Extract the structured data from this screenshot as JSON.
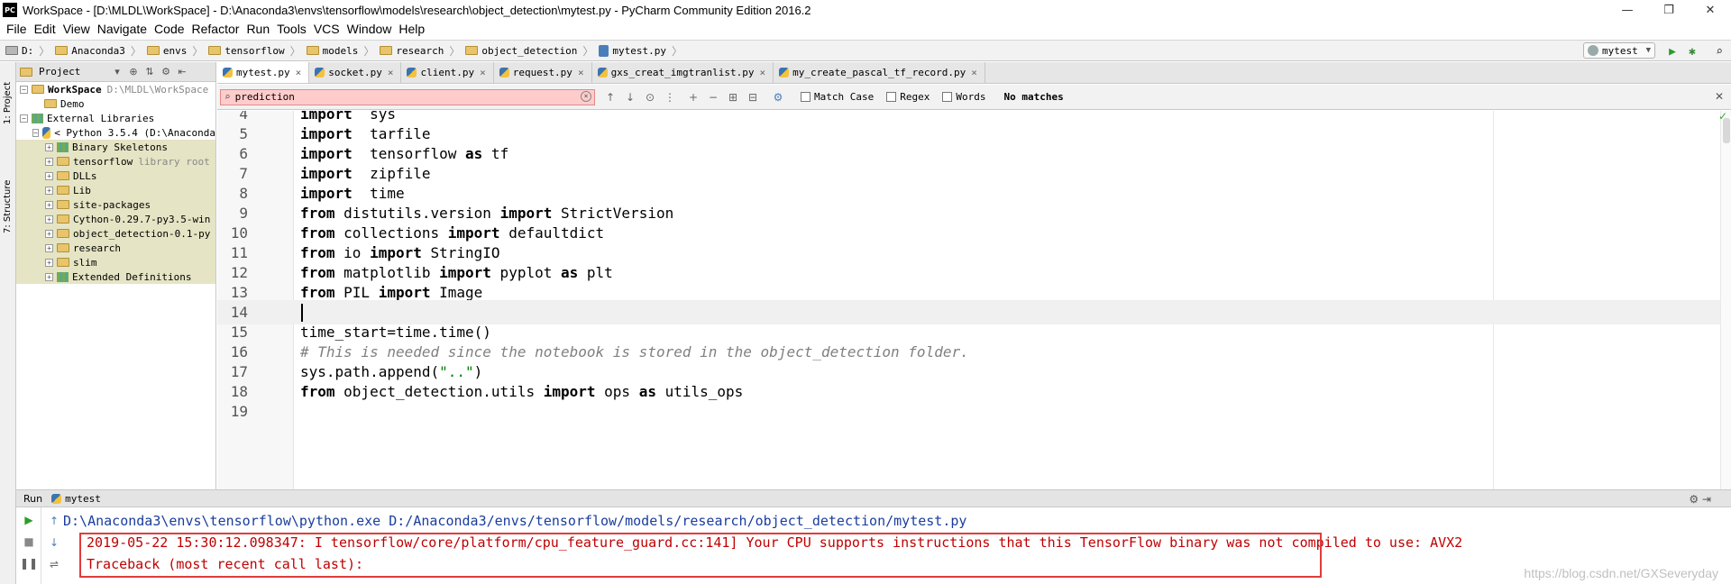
{
  "window": {
    "title": "WorkSpace - [D:\\MLDL\\WorkSpace] - D:\\Anaconda3\\envs\\tensorflow\\models\\research\\object_detection\\mytest.py - PyCharm Community Edition 2016.2",
    "logo_text": "PC",
    "minimize": "—",
    "restore": "❐",
    "close": "✕"
  },
  "menu": [
    "File",
    "Edit",
    "View",
    "Navigate",
    "Code",
    "Refactor",
    "Run",
    "Tools",
    "VCS",
    "Window",
    "Help"
  ],
  "breadcrumb": [
    "D:",
    "Anaconda3",
    "envs",
    "tensorflow",
    "models",
    "research",
    "object_detection",
    "mytest.py"
  ],
  "run_config": "mytest",
  "left_strip": {
    "project_tab": "1: Project",
    "structure_tab": "7: Structure"
  },
  "project_panel": {
    "title": "Project",
    "tree": [
      {
        "label": "WorkSpace",
        "extra": "D:\\MLDL\\WorkSpace",
        "level": 0,
        "toggle": "−",
        "icon": "folder"
      },
      {
        "label": "Demo",
        "level": 1,
        "toggle": "",
        "icon": "folder"
      },
      {
        "label": "External Libraries",
        "level": 0,
        "toggle": "−",
        "icon": "lib"
      },
      {
        "label": "< Python 3.5.4 (D:\\Anaconda",
        "level": 1,
        "toggle": "−",
        "icon": "py"
      },
      {
        "label": "Binary Skeletons",
        "level": 2,
        "toggle": "+",
        "icon": "lib"
      },
      {
        "label": "tensorflow",
        "extra": "library root",
        "level": 2,
        "toggle": "+",
        "icon": "folder"
      },
      {
        "label": "DLLs",
        "level": 2,
        "toggle": "+",
        "icon": "folder"
      },
      {
        "label": "Lib",
        "level": 2,
        "toggle": "+",
        "icon": "folder"
      },
      {
        "label": "site-packages",
        "level": 2,
        "toggle": "+",
        "icon": "folder"
      },
      {
        "label": "Cython-0.29.7-py3.5-win",
        "level": 2,
        "toggle": "+",
        "icon": "folder"
      },
      {
        "label": "object_detection-0.1-py",
        "level": 2,
        "toggle": "+",
        "icon": "folder"
      },
      {
        "label": "research",
        "level": 2,
        "toggle": "+",
        "icon": "folder"
      },
      {
        "label": "slim",
        "level": 2,
        "toggle": "+",
        "icon": "folder"
      },
      {
        "label": "Extended Definitions",
        "level": 2,
        "toggle": "+",
        "icon": "lib"
      }
    ]
  },
  "tabs": [
    {
      "label": "mytest.py",
      "active": true
    },
    {
      "label": "socket.py",
      "active": false
    },
    {
      "label": "client.py",
      "active": false
    },
    {
      "label": "request.py",
      "active": false
    },
    {
      "label": "gxs_creat_imgtranlist.py",
      "active": false
    },
    {
      "label": "my_create_pascal_tf_record.py",
      "active": false
    }
  ],
  "find": {
    "query": "prediction",
    "match_case": "Match Case",
    "regex": "Regex",
    "words": "Words",
    "status": "No matches"
  },
  "code_lines": [
    {
      "n": "4",
      "parts": [
        [
          "kw2",
          "import"
        ],
        [
          "",
          "  sys"
        ]
      ]
    },
    {
      "n": "5",
      "parts": [
        [
          "kw2",
          "import"
        ],
        [
          "",
          "  tarfile"
        ]
      ]
    },
    {
      "n": "6",
      "parts": [
        [
          "kw2",
          "import"
        ],
        [
          "",
          "  tensorflow "
        ],
        [
          "kw2",
          "as"
        ],
        [
          "",
          " tf"
        ]
      ]
    },
    {
      "n": "7",
      "parts": [
        [
          "kw2",
          "import"
        ],
        [
          "",
          "  zipfile"
        ]
      ]
    },
    {
      "n": "8",
      "parts": [
        [
          "kw2",
          "import"
        ],
        [
          "",
          "  time"
        ]
      ]
    },
    {
      "n": "9",
      "parts": [
        [
          "kw2",
          "from"
        ],
        [
          "",
          " distutils.version "
        ],
        [
          "kw2",
          "import"
        ],
        [
          "",
          " StrictVersion"
        ]
      ]
    },
    {
      "n": "10",
      "parts": [
        [
          "kw2",
          "from"
        ],
        [
          "",
          " collections "
        ],
        [
          "kw2",
          "import"
        ],
        [
          "",
          " defaultdict"
        ]
      ]
    },
    {
      "n": "11",
      "parts": [
        [
          "kw2",
          "from"
        ],
        [
          "",
          " io "
        ],
        [
          "kw2",
          "import"
        ],
        [
          "",
          " StringIO"
        ]
      ]
    },
    {
      "n": "12",
      "parts": [
        [
          "kw2",
          "from"
        ],
        [
          "",
          " matplotlib "
        ],
        [
          "kw2",
          "import"
        ],
        [
          "",
          " pyplot "
        ],
        [
          "kw2",
          "as"
        ],
        [
          "",
          " plt"
        ]
      ]
    },
    {
      "n": "13",
      "parts": [
        [
          "kw2",
          "from"
        ],
        [
          "",
          " PIL "
        ],
        [
          "kw2",
          "import"
        ],
        [
          "",
          " Image"
        ]
      ]
    },
    {
      "n": "14",
      "parts": [],
      "current": true
    },
    {
      "n": "15",
      "parts": [
        [
          "",
          "time_start=time.time()"
        ]
      ]
    },
    {
      "n": "16",
      "parts": [
        [
          "cm",
          "# This is needed since the notebook is stored in the object_detection folder."
        ]
      ]
    },
    {
      "n": "17",
      "parts": [
        [
          "",
          "sys.path.append("
        ],
        [
          "st",
          "\"..\""
        ],
        [
          "",
          ")"
        ]
      ]
    },
    {
      "n": "18",
      "parts": [
        [
          "kw2",
          "from"
        ],
        [
          "",
          " object_detection.utils "
        ],
        [
          "kw2",
          "import"
        ],
        [
          "",
          " ops "
        ],
        [
          "kw2",
          "as"
        ],
        [
          "",
          " utils_ops"
        ]
      ]
    },
    {
      "n": "19",
      "parts": []
    }
  ],
  "run_panel": {
    "label": "Run",
    "tab": "mytest",
    "console": [
      {
        "cls": "c-blue",
        "text": "D:\\Anaconda3\\envs\\tensorflow\\python.exe D:/Anaconda3/envs/tensorflow/models/research/object_detection/mytest.py"
      },
      {
        "cls": "c-red",
        "text": "2019-05-22 15:30:12.098347: I tensorflow/core/platform/cpu_feature_guard.cc:141] Your CPU supports instructions that this TensorFlow binary was not compiled to use: AVX2"
      },
      {
        "cls": "c-red",
        "text": "Traceback (most recent call last):"
      }
    ]
  },
  "watermark": "https://blog.csdn.net/GXSeveryday"
}
